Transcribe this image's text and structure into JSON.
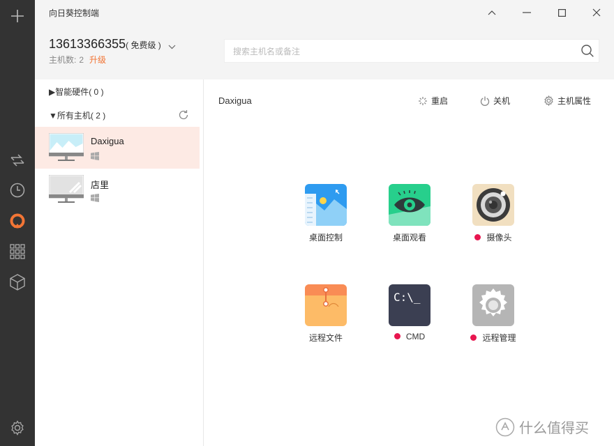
{
  "window": {
    "title": "向日葵控制端"
  },
  "account": {
    "phone": "13613366355",
    "tier": "( 免费级 )",
    "host_count_label": "主机数:",
    "host_count": "2",
    "upgrade_label": "升级"
  },
  "search": {
    "placeholder": "搜索主机名或备注"
  },
  "sidebar": {
    "groups": [
      {
        "label": "▶智能硬件( 0 )"
      },
      {
        "label": "▼所有主机( 2 )"
      }
    ],
    "hosts": [
      {
        "name": "Daxigua",
        "os": "windows-icon",
        "selected": true
      },
      {
        "name": "店里",
        "os": "windows-icon",
        "selected": false
      }
    ]
  },
  "main": {
    "current_host": "Daxigua",
    "actions": [
      {
        "label": "重启",
        "icon": "restart-icon"
      },
      {
        "label": "关机",
        "icon": "power-icon"
      },
      {
        "label": "主机属性",
        "icon": "gear-icon"
      }
    ],
    "features": [
      {
        "label": "桌面控制",
        "icon": "desktop-control-icon",
        "status_dot": false
      },
      {
        "label": "桌面观看",
        "icon": "desktop-view-icon",
        "status_dot": false
      },
      {
        "label": "摄像头",
        "icon": "camera-icon",
        "status_dot": true
      },
      {
        "label": "远程文件",
        "icon": "remote-file-icon",
        "status_dot": false
      },
      {
        "label": "CMD",
        "icon": "cmd-icon",
        "status_dot": true,
        "icon_text": "C:\\_"
      },
      {
        "label": "远程管理",
        "icon": "remote-manage-icon",
        "status_dot": true
      }
    ]
  },
  "watermark": {
    "text": "什么值得买"
  },
  "colors": {
    "rail": "#333333",
    "accent": "#f27535",
    "selected_row": "#fdeae4",
    "status_dot": "#e8164f"
  }
}
